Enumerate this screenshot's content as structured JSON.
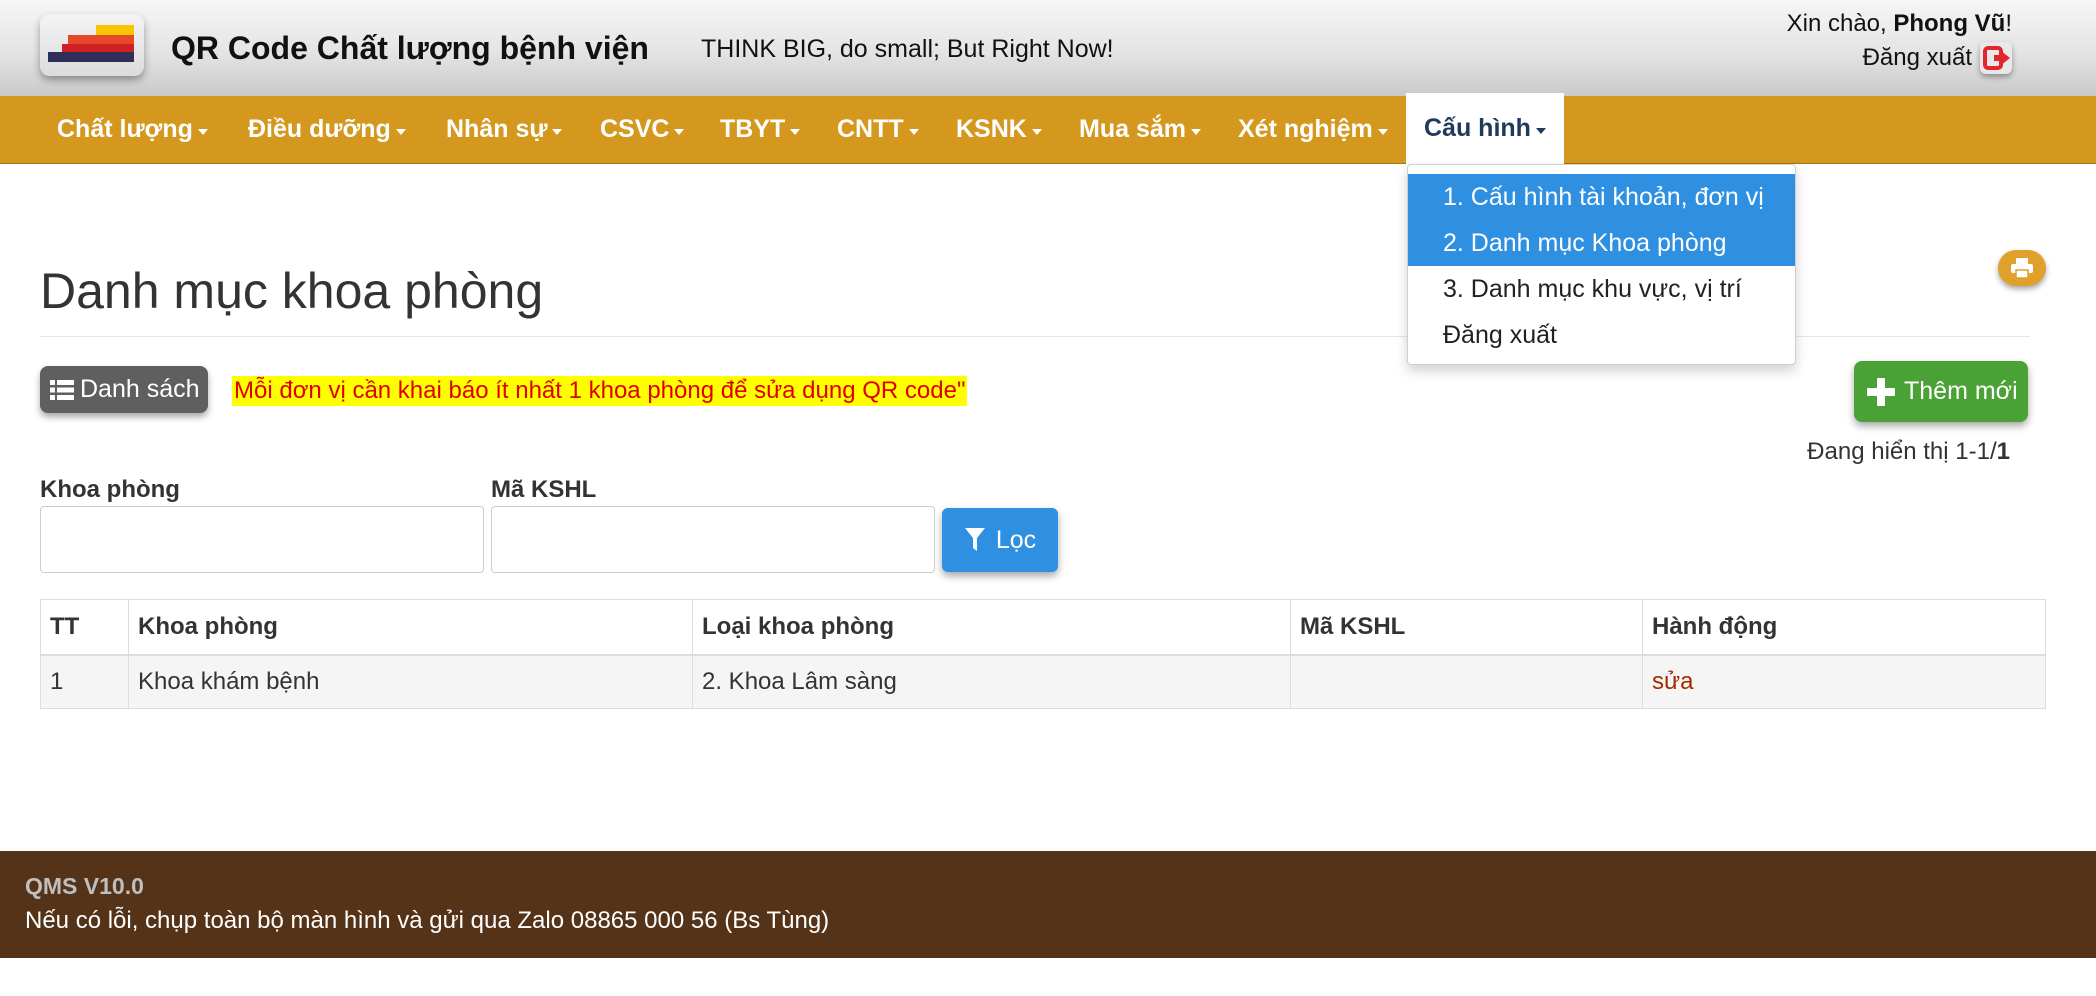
{
  "header": {
    "app_title": "QR Code Chất lượng bệnh viện",
    "slogan": "THINK BIG, do small; But Right Now!",
    "greeting_prefix": "Xin chào, ",
    "user_name": "Phong Vũ",
    "greeting_suffix": "!",
    "logout_label": "Đăng xuất",
    "logout_icon": "logout-icon"
  },
  "nav": {
    "items": [
      {
        "label": "Chất lượng"
      },
      {
        "label": "Điều dưỡng"
      },
      {
        "label": "Nhân sự"
      },
      {
        "label": "CSVC"
      },
      {
        "label": "TBYT"
      },
      {
        "label": "CNTT"
      },
      {
        "label": "KSNK"
      },
      {
        "label": "Mua sắm"
      },
      {
        "label": "Xét nghiệm"
      },
      {
        "label": "Cấu hình",
        "active": true
      }
    ],
    "dropdown": [
      {
        "label": "1. Cấu hình tài khoản, đơn vị",
        "highlighted": true
      },
      {
        "label": "2. Danh mục Khoa phòng",
        "highlighted": true
      },
      {
        "label": "3. Danh mục khu vực, vị trí",
        "highlighted": false
      },
      {
        "label": "Đăng xuất",
        "highlighted": false
      }
    ]
  },
  "main": {
    "page_title": "Danh mục khoa phòng",
    "list_button": "Danh sách",
    "notice": "Mỗi đơn vị cần khai báo ít nhất 1 khoa phòng để sửa dụng QR code\"",
    "add_button": "Thêm mới",
    "showing_prefix": "Đang hiển thị 1-1/",
    "showing_total": "1",
    "filter": {
      "khoa_phong_label": "Khoa phòng",
      "khoa_phong_value": "",
      "ma_kshl_label": "Mã KSHL",
      "ma_kshl_value": "",
      "filter_button": "Lọc"
    },
    "table": {
      "headers": [
        "TT",
        "Khoa phòng",
        "Loại khoa phòng",
        "Mã KSHL",
        "Hành động"
      ],
      "rows": [
        {
          "tt": "1",
          "khoa_phong": "Khoa khám bệnh",
          "loai": "2. Khoa Lâm sàng",
          "ma": "",
          "action": "sửa"
        }
      ]
    }
  },
  "footer": {
    "version": "QMS V10.0",
    "message": "Nếu có lỗi, chụp toàn bộ màn hình và gửi qua Zalo 08865 000 56 (Bs Tùng)"
  },
  "colors": {
    "navbar": "#d4981f",
    "dropdown_highlight": "#2f8fe0",
    "footer": "#553318",
    "add_button": "#4aa236",
    "notice_bg": "#ffff00",
    "notice_text": "#e00000"
  }
}
